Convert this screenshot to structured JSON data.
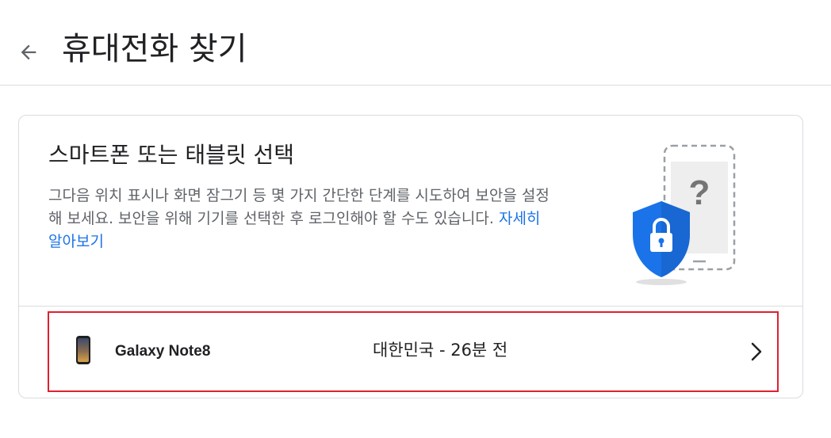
{
  "header": {
    "back_icon": "arrow-back-icon",
    "title": "휴대전화 찾기"
  },
  "card": {
    "title": "스마트폰 또는 태블릿 선택",
    "description": "그다음 위치 표시나 화면 잠그기 등 몇 가지 간단한 단계를 시도하여 보안을 설정해 보세요. 보안을 위해 기기를 선택한 후 로그인해야 할 수도 있습니다.",
    "learn_more": "자세히 알아보기",
    "illustration_icons": [
      "phone-question-icon",
      "security-shield-lock-icon"
    ]
  },
  "devices": [
    {
      "name": "Galaxy Note8",
      "location": "대한민국 - 26분 전",
      "icon": "phone-icon"
    }
  ],
  "colors": {
    "link": "#1a73e8",
    "shield": "#1a73e8",
    "highlight_border": "#e0202f",
    "divider": "#dadce0"
  }
}
